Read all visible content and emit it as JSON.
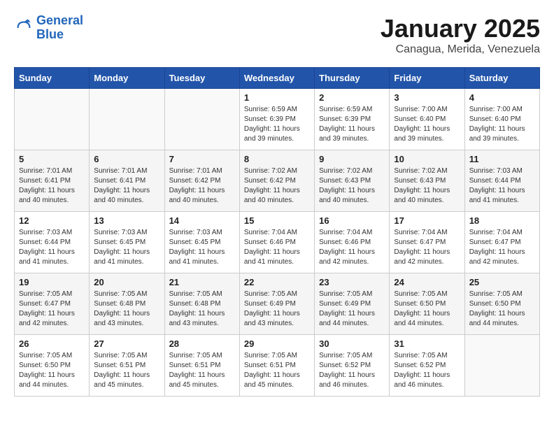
{
  "header": {
    "logo_line1": "General",
    "logo_line2": "Blue",
    "title": "January 2025",
    "subtitle": "Canagua, Merida, Venezuela"
  },
  "days_of_week": [
    "Sunday",
    "Monday",
    "Tuesday",
    "Wednesday",
    "Thursday",
    "Friday",
    "Saturday"
  ],
  "weeks": [
    [
      {
        "day": "",
        "info": ""
      },
      {
        "day": "",
        "info": ""
      },
      {
        "day": "",
        "info": ""
      },
      {
        "day": "1",
        "info": "Sunrise: 6:59 AM\nSunset: 6:39 PM\nDaylight: 11 hours and 39 minutes."
      },
      {
        "day": "2",
        "info": "Sunrise: 6:59 AM\nSunset: 6:39 PM\nDaylight: 11 hours and 39 minutes."
      },
      {
        "day": "3",
        "info": "Sunrise: 7:00 AM\nSunset: 6:40 PM\nDaylight: 11 hours and 39 minutes."
      },
      {
        "day": "4",
        "info": "Sunrise: 7:00 AM\nSunset: 6:40 PM\nDaylight: 11 hours and 39 minutes."
      }
    ],
    [
      {
        "day": "5",
        "info": "Sunrise: 7:01 AM\nSunset: 6:41 PM\nDaylight: 11 hours and 40 minutes."
      },
      {
        "day": "6",
        "info": "Sunrise: 7:01 AM\nSunset: 6:41 PM\nDaylight: 11 hours and 40 minutes."
      },
      {
        "day": "7",
        "info": "Sunrise: 7:01 AM\nSunset: 6:42 PM\nDaylight: 11 hours and 40 minutes."
      },
      {
        "day": "8",
        "info": "Sunrise: 7:02 AM\nSunset: 6:42 PM\nDaylight: 11 hours and 40 minutes."
      },
      {
        "day": "9",
        "info": "Sunrise: 7:02 AM\nSunset: 6:43 PM\nDaylight: 11 hours and 40 minutes."
      },
      {
        "day": "10",
        "info": "Sunrise: 7:02 AM\nSunset: 6:43 PM\nDaylight: 11 hours and 40 minutes."
      },
      {
        "day": "11",
        "info": "Sunrise: 7:03 AM\nSunset: 6:44 PM\nDaylight: 11 hours and 41 minutes."
      }
    ],
    [
      {
        "day": "12",
        "info": "Sunrise: 7:03 AM\nSunset: 6:44 PM\nDaylight: 11 hours and 41 minutes."
      },
      {
        "day": "13",
        "info": "Sunrise: 7:03 AM\nSunset: 6:45 PM\nDaylight: 11 hours and 41 minutes."
      },
      {
        "day": "14",
        "info": "Sunrise: 7:03 AM\nSunset: 6:45 PM\nDaylight: 11 hours and 41 minutes."
      },
      {
        "day": "15",
        "info": "Sunrise: 7:04 AM\nSunset: 6:46 PM\nDaylight: 11 hours and 41 minutes."
      },
      {
        "day": "16",
        "info": "Sunrise: 7:04 AM\nSunset: 6:46 PM\nDaylight: 11 hours and 42 minutes."
      },
      {
        "day": "17",
        "info": "Sunrise: 7:04 AM\nSunset: 6:47 PM\nDaylight: 11 hours and 42 minutes."
      },
      {
        "day": "18",
        "info": "Sunrise: 7:04 AM\nSunset: 6:47 PM\nDaylight: 11 hours and 42 minutes."
      }
    ],
    [
      {
        "day": "19",
        "info": "Sunrise: 7:05 AM\nSunset: 6:47 PM\nDaylight: 11 hours and 42 minutes."
      },
      {
        "day": "20",
        "info": "Sunrise: 7:05 AM\nSunset: 6:48 PM\nDaylight: 11 hours and 43 minutes."
      },
      {
        "day": "21",
        "info": "Sunrise: 7:05 AM\nSunset: 6:48 PM\nDaylight: 11 hours and 43 minutes."
      },
      {
        "day": "22",
        "info": "Sunrise: 7:05 AM\nSunset: 6:49 PM\nDaylight: 11 hours and 43 minutes."
      },
      {
        "day": "23",
        "info": "Sunrise: 7:05 AM\nSunset: 6:49 PM\nDaylight: 11 hours and 44 minutes."
      },
      {
        "day": "24",
        "info": "Sunrise: 7:05 AM\nSunset: 6:50 PM\nDaylight: 11 hours and 44 minutes."
      },
      {
        "day": "25",
        "info": "Sunrise: 7:05 AM\nSunset: 6:50 PM\nDaylight: 11 hours and 44 minutes."
      }
    ],
    [
      {
        "day": "26",
        "info": "Sunrise: 7:05 AM\nSunset: 6:50 PM\nDaylight: 11 hours and 44 minutes."
      },
      {
        "day": "27",
        "info": "Sunrise: 7:05 AM\nSunset: 6:51 PM\nDaylight: 11 hours and 45 minutes."
      },
      {
        "day": "28",
        "info": "Sunrise: 7:05 AM\nSunset: 6:51 PM\nDaylight: 11 hours and 45 minutes."
      },
      {
        "day": "29",
        "info": "Sunrise: 7:05 AM\nSunset: 6:51 PM\nDaylight: 11 hours and 45 minutes."
      },
      {
        "day": "30",
        "info": "Sunrise: 7:05 AM\nSunset: 6:52 PM\nDaylight: 11 hours and 46 minutes."
      },
      {
        "day": "31",
        "info": "Sunrise: 7:05 AM\nSunset: 6:52 PM\nDaylight: 11 hours and 46 minutes."
      },
      {
        "day": "",
        "info": ""
      }
    ]
  ]
}
